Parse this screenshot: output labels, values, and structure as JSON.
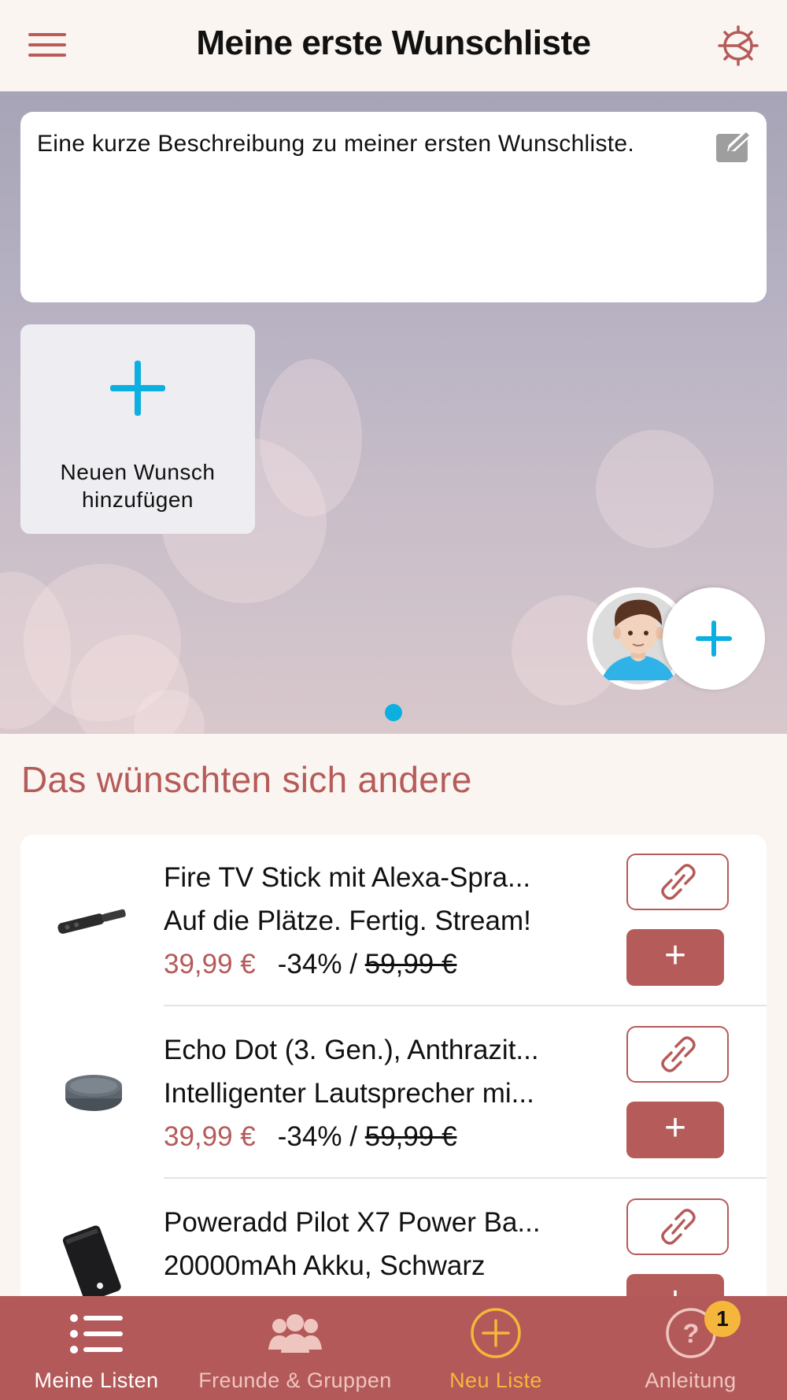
{
  "header": {
    "title": "Meine erste Wunschliste",
    "menu_icon": "hamburger-menu-icon",
    "settings_icon": "gear-icon"
  },
  "list": {
    "description": "Eine kurze Beschreibung zu meiner ersten Wunschliste.",
    "add_wish_label_line1": "Neuen Wunsch",
    "add_wish_label_line2": "hinzufügen",
    "page_indicator": {
      "current": 1,
      "total": 1
    }
  },
  "suggestions": {
    "title": "Das wünschten sich andere",
    "items": [
      {
        "name": "Fire TV Stick mit Alexa-Spra...",
        "subtitle": "Auf die Plätze. Fertig. Stream!",
        "price": "39,99 €",
        "discount": "-34% / ",
        "old_price": "59,99 €",
        "plus": "+"
      },
      {
        "name": "Echo Dot (3. Gen.), Anthrazit...",
        "subtitle": "Intelligenter Lautsprecher mi...",
        "price": "39,99 €",
        "discount": "-34% / ",
        "old_price": "59,99 €",
        "plus": "+"
      },
      {
        "name": "Poweradd Pilot X7 Power Ba...",
        "subtitle": "20000mAh Akku, Schwarz",
        "plus": "+"
      }
    ]
  },
  "tabbar": {
    "tabs": [
      {
        "label": "Meine Listen",
        "icon": "list-icon",
        "color": "#ffffff"
      },
      {
        "label": "Freunde & Gruppen",
        "icon": "group-icon",
        "color": "#efc5c0"
      },
      {
        "label": "Neu Liste",
        "icon": "plus-circle-icon",
        "color": "#f5b73b"
      },
      {
        "label": "Anleitung",
        "icon": "help-icon",
        "color": "#efc5c0",
        "badge": "1"
      }
    ]
  },
  "colors": {
    "accent": "#b55b59",
    "cyan": "#0cb0e0",
    "tab_active_yellow": "#f5b73b"
  }
}
